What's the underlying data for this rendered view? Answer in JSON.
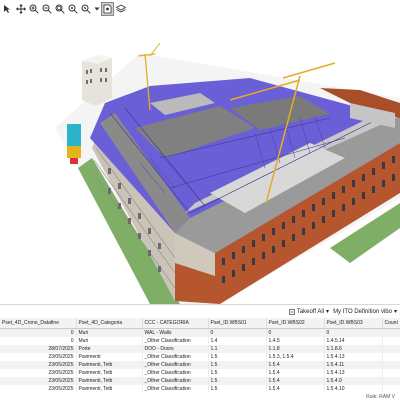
{
  "toolbar": {
    "icons": [
      "select-icon",
      "pan-icon",
      "zoom-in-icon",
      "zoom-out-icon",
      "zoom-fit-icon",
      "zoom-window-icon",
      "zoom-selection-icon",
      "dropdown-arrow-icon",
      "view-icon",
      "layers-icon"
    ]
  },
  "panel_toolbar": {
    "takeoff_label": "Takeoff All",
    "definition_label": "My ITO Definition vibo"
  },
  "table": {
    "columns": [
      "Pset_4D_Crono_Datafine",
      "Pset_4D_Categoria",
      "CCC - CATEGORIA",
      "Pset_ID.WBS01",
      "Pset_ID.WBS02",
      "Pset_ID.WBS03",
      "Count"
    ],
    "rows": [
      [
        "0",
        "Muri",
        "WAL - Walls",
        "0",
        "0",
        "0",
        ""
      ],
      [
        "0",
        "Muri",
        "_Other Classification",
        "1.4",
        "1.4.5",
        "1.4.5.14",
        ""
      ],
      [
        "28/07/2025",
        "Porte",
        "DOO - Doors",
        "1.1",
        "1.1.8",
        "1.1.8.6",
        ""
      ],
      [
        "23/05/2025",
        "Pavimenti",
        "_Other Classification",
        "1.5",
        "1.5.3, 1.5.4",
        "1.5.4.13",
        ""
      ],
      [
        "23/05/2025",
        "Pavimenti, Tetti",
        "_Other Classification",
        "1.5",
        "1.5.4",
        "1.5.4.11",
        ""
      ],
      [
        "23/05/2025",
        "Pavimenti, Tetti",
        "_Other Classification",
        "1.5",
        "1.5.4",
        "1.5.4.13",
        ""
      ],
      [
        "23/05/2025",
        "Pavimenti, Tetti",
        "_Other Classification",
        "1.5",
        "1.5.4",
        "1.5.4.9",
        ""
      ],
      [
        "23/05/2025",
        "Pavimenti, Tetti",
        "_Other Classification",
        "1.5",
        "1.5.4",
        "1.5.4.10",
        ""
      ]
    ]
  },
  "status": {
    "text": "Rule: RAM V"
  },
  "colors": {
    "selection_blue": "#6a5fd6",
    "brick": "#b5562e",
    "roof_grey": "#8a8a8a",
    "ground_green": "#7fae66",
    "crane_yellow": "#e0b020"
  }
}
